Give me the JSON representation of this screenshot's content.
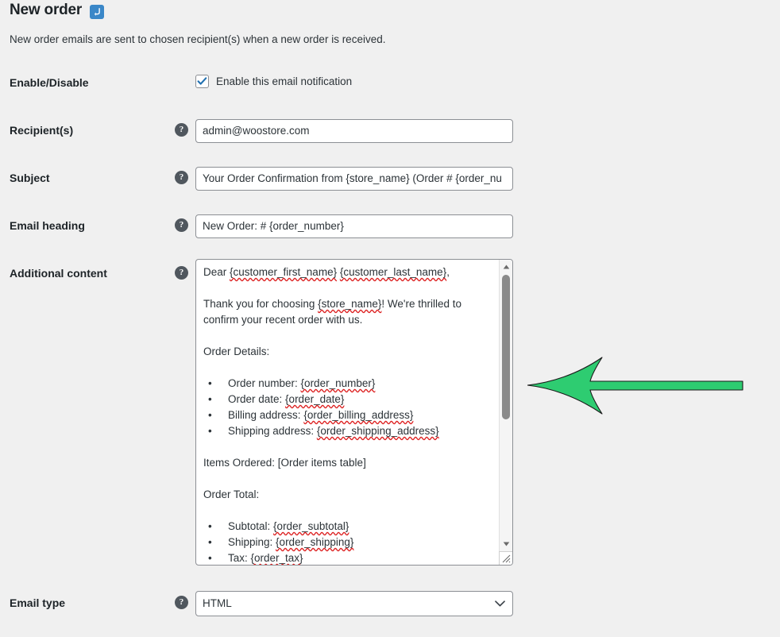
{
  "header": {
    "title": "New order",
    "badge_icon": "return-arrow-icon",
    "description": "New order emails are sent to chosen recipient(s) when a new order is received."
  },
  "help_icon_glyph": "?",
  "rows": {
    "enable": {
      "label": "Enable/Disable",
      "checkbox_label": "Enable this email notification",
      "checked": true
    },
    "recipients": {
      "label": "Recipient(s)",
      "value": "admin@woostore.com",
      "help": "?"
    },
    "subject": {
      "label": "Subject",
      "value": "Your Order Confirmation from {store_name} (Order # {order_number})",
      "visible_value": "Your Order Confirmation from {store_name} (Order # {order_nu",
      "help": "?"
    },
    "email_heading": {
      "label": "Email heading",
      "value": "New Order: # {order_number}",
      "help": "?"
    },
    "additional_content": {
      "label": "Additional content",
      "help": "?",
      "lines": [
        {
          "type": "p",
          "parts": [
            {
              "t": "Dear "
            },
            {
              "t": "{customer_first_name}",
              "sp": true
            },
            {
              "t": " "
            },
            {
              "t": "{customer_last_name}",
              "sp": true
            },
            {
              "t": ","
            }
          ]
        },
        {
          "type": "blank"
        },
        {
          "type": "p",
          "parts": [
            {
              "t": "Thank you for choosing "
            },
            {
              "t": "{store_name}",
              "sp": true
            },
            {
              "t": "! We're thrilled to"
            }
          ]
        },
        {
          "type": "p",
          "parts": [
            {
              "t": "confirm your recent order with us."
            }
          ]
        },
        {
          "type": "blank"
        },
        {
          "type": "p",
          "parts": [
            {
              "t": "Order Details:"
            }
          ]
        },
        {
          "type": "blank"
        },
        {
          "type": "li",
          "bullet": "•",
          "parts": [
            {
              "t": "Order number: "
            },
            {
              "t": "{order_number}",
              "sp": true
            }
          ]
        },
        {
          "type": "li",
          "bullet": "•",
          "parts": [
            {
              "t": "Order date: "
            },
            {
              "t": "{order_date}",
              "sp": true
            }
          ]
        },
        {
          "type": "li",
          "bullet": "•",
          "parts": [
            {
              "t": "Billing address: "
            },
            {
              "t": "{order_billing_address}",
              "sp": true
            }
          ]
        },
        {
          "type": "li",
          "bullet": "•",
          "parts": [
            {
              "t": "Shipping address: "
            },
            {
              "t": "{order_shipping_address}",
              "sp": true
            }
          ]
        },
        {
          "type": "blank"
        },
        {
          "type": "p",
          "parts": [
            {
              "t": "Items Ordered: [Order items table]"
            }
          ]
        },
        {
          "type": "blank"
        },
        {
          "type": "p",
          "parts": [
            {
              "t": "Order Total:"
            }
          ]
        },
        {
          "type": "blank"
        },
        {
          "type": "li",
          "bullet": "•",
          "parts": [
            {
              "t": "Subtotal: "
            },
            {
              "t": "{order_subtotal}",
              "sp": true
            }
          ]
        },
        {
          "type": "li",
          "bullet": "•",
          "parts": [
            {
              "t": "Shipping: "
            },
            {
              "t": "{order_shipping}",
              "sp": true
            }
          ]
        },
        {
          "type": "li",
          "bullet": "•",
          "parts": [
            {
              "t": "Tax: "
            },
            {
              "t": "{order_tax}",
              "sp": true
            }
          ]
        }
      ]
    },
    "email_type": {
      "label": "Email type",
      "value": "HTML",
      "help": "?",
      "options": [
        "HTML"
      ]
    }
  },
  "annotation": {
    "shape": "left-arrow",
    "color": "#2ecc71",
    "outline": "#1a1a1a"
  },
  "colors": {
    "page_background": "#f0f0f0",
    "field_border": "#8c8f94",
    "text": "#2c3338",
    "accent_blue": "#3a87c8",
    "checkbox_check": "#2271b1",
    "spellcheck_underline": "#dd2222"
  }
}
